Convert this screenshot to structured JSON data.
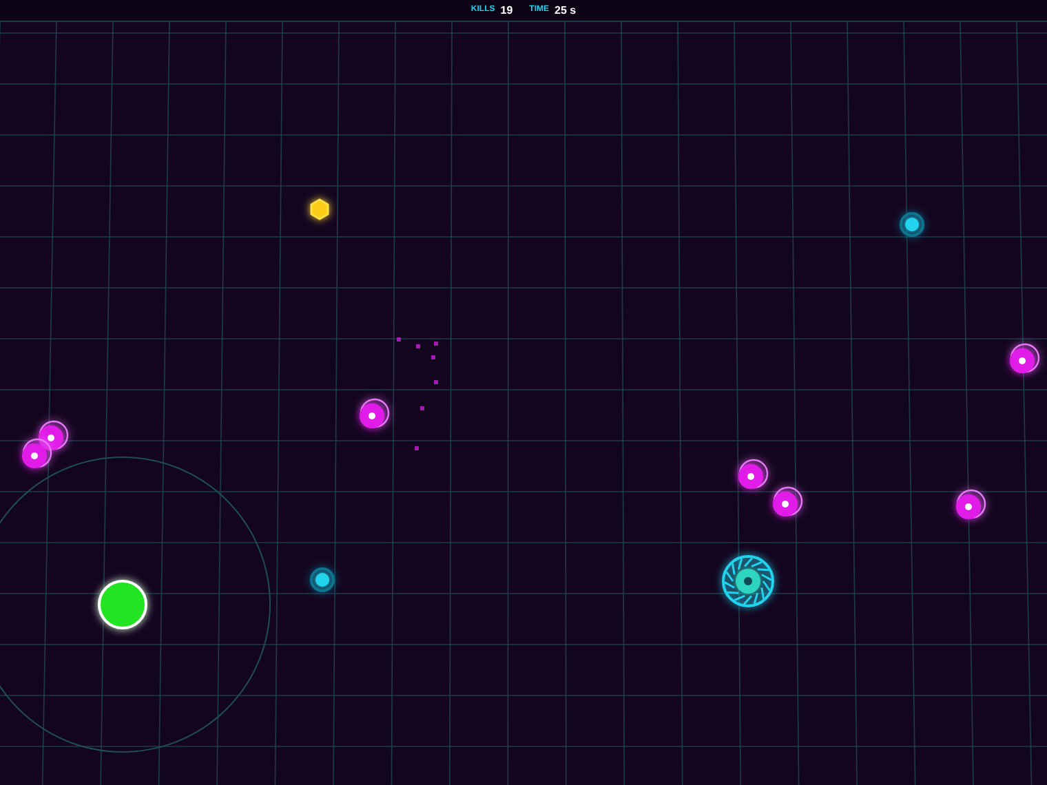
{
  "hud": [
    {
      "label": "KILLS",
      "value": "19"
    },
    {
      "label": "TIME",
      "value": "25 s"
    }
  ]
}
